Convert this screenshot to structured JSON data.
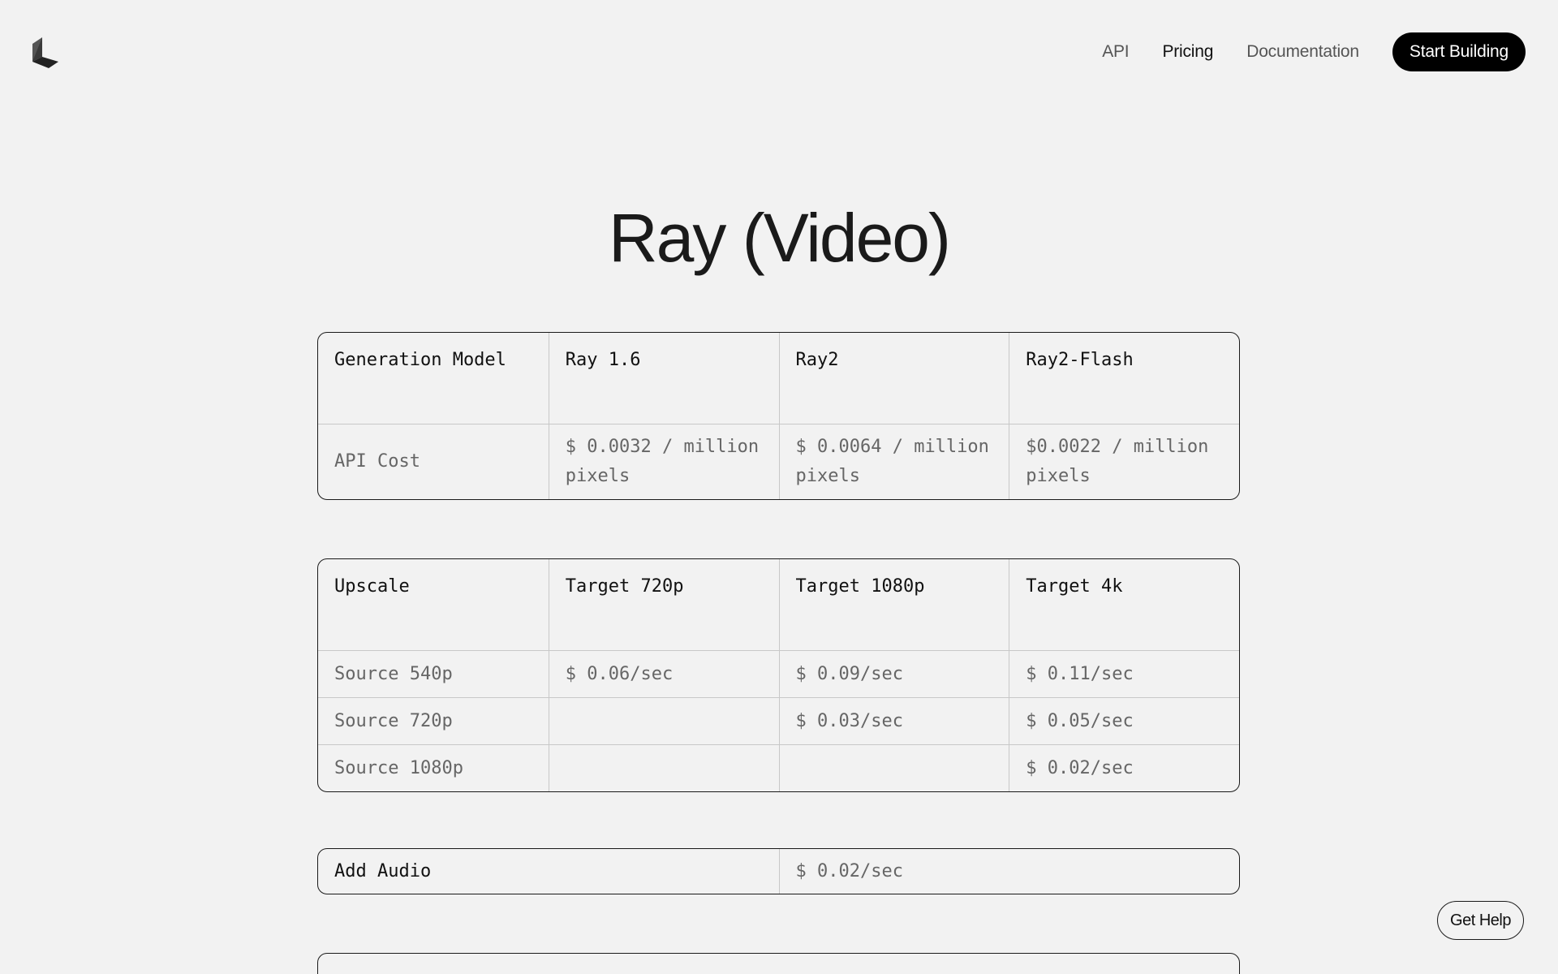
{
  "nav": {
    "items": [
      "API",
      "Pricing",
      "Documentation"
    ],
    "active": "Pricing",
    "cta_label": "Start Building"
  },
  "logo": {
    "icon": "luma-logo-icon"
  },
  "title": "Ray (Video)",
  "generation_table": {
    "header": [
      "Generation Model",
      "Ray 1.6",
      "Ray2",
      "Ray2-Flash"
    ],
    "rows": [
      [
        "API Cost",
        "$ 0.0032 / million pixels",
        "$ 0.0064 / million pixels",
        "$0.0022 / million pixels"
      ]
    ]
  },
  "upscale_table": {
    "header": [
      "Upscale",
      "Target 720p",
      "Target 1080p",
      "Target 4k"
    ],
    "rows": [
      [
        "Source 540p",
        "$ 0.06/sec",
        "$ 0.09/sec",
        "$ 0.11/sec"
      ],
      [
        "Source 720p",
        "",
        "$ 0.03/sec",
        "$ 0.05/sec"
      ],
      [
        "Source 1080p",
        "",
        "",
        "$ 0.02/sec"
      ]
    ]
  },
  "audio_table": {
    "label": "Add Audio",
    "value": "$ 0.02/sec"
  },
  "help_button_label": "Get Help",
  "colors": {
    "background": "#f2f2f2",
    "cta_background": "#000000",
    "cta_text": "#ffffff",
    "border": "#1a1a1a",
    "divider": "#c8c8c8",
    "muted_text": "#666666"
  }
}
